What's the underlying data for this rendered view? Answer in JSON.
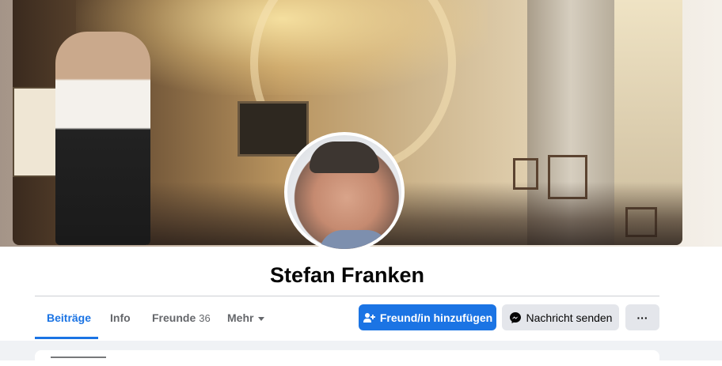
{
  "profile": {
    "name": "Stefan Franken"
  },
  "tabs": [
    {
      "label": "Beiträge",
      "active": true
    },
    {
      "label": "Info"
    },
    {
      "label": "Freunde",
      "count": "36"
    },
    {
      "label": "Mehr"
    }
  ],
  "actions": {
    "add_friend": "Freund/in hinzufügen",
    "message": "Nachricht senden",
    "more": "···"
  },
  "colors": {
    "accent": "#1b74e4",
    "secondary_button": "#e4e6eb",
    "page_background": "#f0f2f5"
  },
  "icons": {
    "add_friend_icon": "person-plus-icon",
    "message_icon": "messenger-icon",
    "mehr_caret": "caret-down-icon"
  }
}
